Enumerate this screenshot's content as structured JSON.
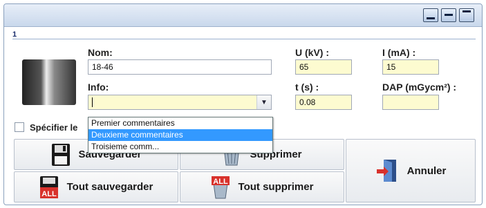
{
  "panel": {
    "number": "1"
  },
  "labels": {
    "nom": "Nom:",
    "info": "Info:",
    "u_kv": "U (kV) :",
    "i_ma": "I (mA) :",
    "t_s": "t (s) :",
    "dap": "DAP (mGycm²) :",
    "specifier": "Spécifier le"
  },
  "fields": {
    "nom": "18-46",
    "info": "",
    "u_kv": "65",
    "i_ma": "15",
    "t_s": "0.08",
    "dap": ""
  },
  "dropdown": {
    "options": [
      "Premier commentaires",
      "Deuxieme commentaires",
      "Troisieme comm..."
    ],
    "selected_index": 1
  },
  "buttons": {
    "sauvegarder": "Sauvegarder",
    "supprimer": "Supprimer",
    "tout_sauvegarder": "Tout sauvegarder",
    "tout_supprimer": "Tout supprimer",
    "annuler": "Annuler"
  },
  "icons": {
    "save": "floppy-disk-icon",
    "delete": "trash-bin-icon",
    "save_all": "save-all-icon",
    "delete_all": "delete-all-icon",
    "cancel": "door-exit-icon",
    "all_text": "ALL"
  },
  "colors": {
    "field_yellow": "#fdfbd0",
    "selection": "#3399ff"
  }
}
